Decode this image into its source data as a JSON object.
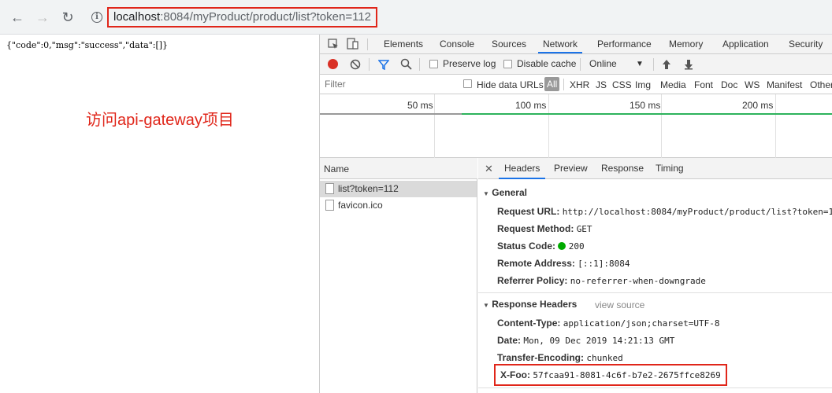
{
  "browser": {
    "back_icon": "←",
    "forward_icon": "→",
    "reload_icon": "↻",
    "info_icon": "i",
    "url_host": "localhost",
    "url_rest": ":8084/myProduct/product/list?token=112"
  },
  "page": {
    "json_text": "{\"code\":0,\"msg\":\"success\",\"data\":[]}",
    "note": "访问api-gateway项目"
  },
  "devtools": {
    "tabs": [
      "Elements",
      "Console",
      "Sources",
      "Network",
      "Performance",
      "Memory",
      "Application",
      "Security"
    ],
    "active_tab": "Network",
    "toolbar": {
      "preserve_log": "Preserve log",
      "disable_cache": "Disable cache",
      "throttle": "Online",
      "record_color": "#d93025"
    },
    "filter": {
      "placeholder": "Filter",
      "hide_data_urls": "Hide data URLs",
      "types": [
        "All",
        "XHR",
        "JS",
        "CSS",
        "Img",
        "Media",
        "Font",
        "Doc",
        "WS",
        "Manifest",
        "Other"
      ]
    },
    "timeline": {
      "ticks": [
        "50 ms",
        "100 ms",
        "150 ms",
        "200 ms"
      ]
    },
    "list": {
      "header": "Name",
      "requests": [
        "list?token=112",
        "favicon.ico"
      ]
    },
    "detail": {
      "tabs": [
        "Headers",
        "Preview",
        "Response",
        "Timing"
      ],
      "active": "Headers",
      "general_title": "General",
      "general": [
        {
          "k": "Request URL:",
          "v": "http://localhost:8084/myProduct/product/list?token=1"
        },
        {
          "k": "Request Method:",
          "v": "GET"
        },
        {
          "k": "Status Code:",
          "v": "200"
        },
        {
          "k": "Remote Address:",
          "v": "[::1]:8084"
        },
        {
          "k": "Referrer Policy:",
          "v": "no-referrer-when-downgrade"
        }
      ],
      "response_title": "Response Headers",
      "view_source": "view source",
      "response": [
        {
          "k": "Content-Type:",
          "v": "application/json;charset=UTF-8"
        },
        {
          "k": "Date:",
          "v": "Mon, 09 Dec 2019 14:21:13 GMT"
        },
        {
          "k": "Transfer-Encoding:",
          "v": "chunked"
        },
        {
          "k": "X-Foo:",
          "v": "57fcaa91-8081-4c6f-b7e2-2675ffce8269"
        }
      ]
    }
  }
}
